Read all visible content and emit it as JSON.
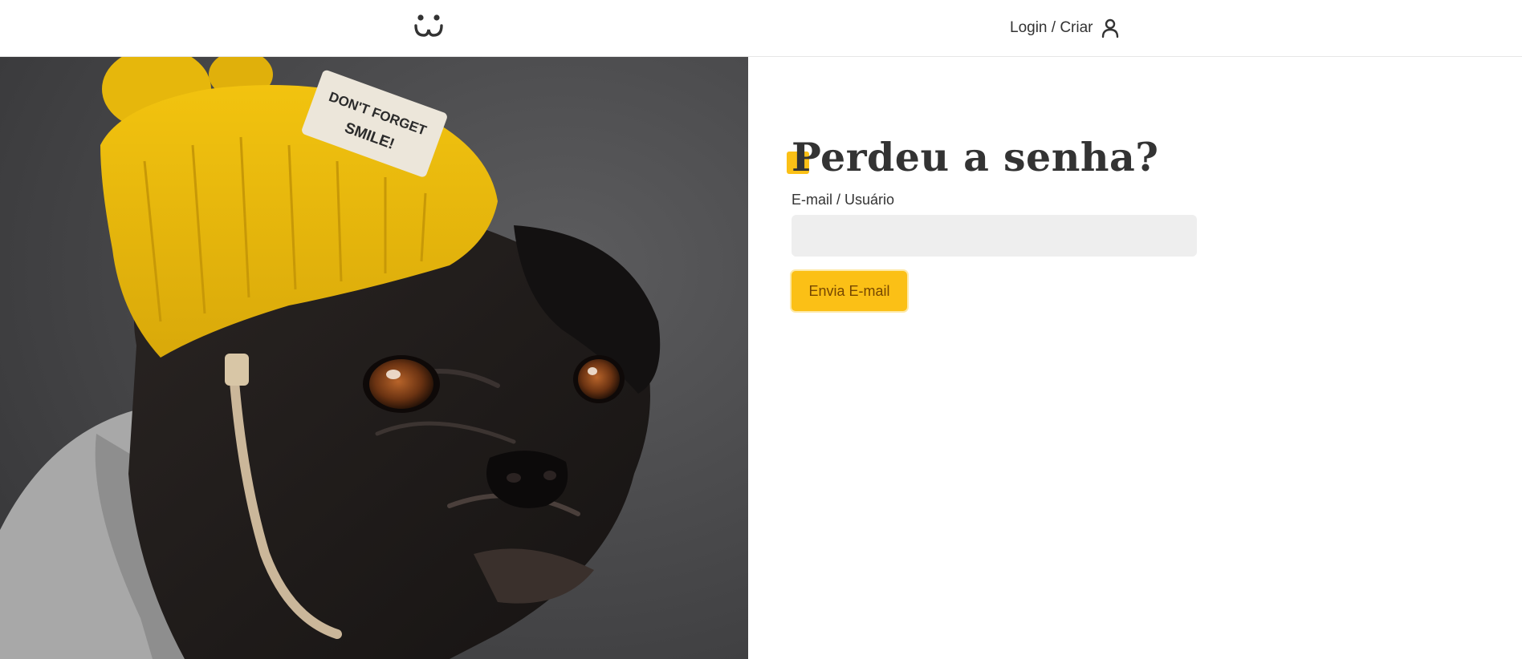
{
  "header": {
    "logo_icon": "dog-face-icon",
    "login_label": "Login / Criar",
    "user_icon": "user-icon"
  },
  "photo": {
    "subject": "pug-in-yellow-beanie",
    "hat_patch_lines": [
      "DON'T FORGET",
      "SMILE!"
    ]
  },
  "form": {
    "title": "Perdeu a senha?",
    "email_label": "E-mail / Usuário",
    "email_value": "",
    "email_placeholder": "",
    "submit_label": "Envia E-mail"
  },
  "colors": {
    "accent": "#fbc016",
    "button_text": "#764701",
    "text": "#333333",
    "input_bg": "#eeeeee",
    "photo_bg": "#4a4a4c"
  }
}
